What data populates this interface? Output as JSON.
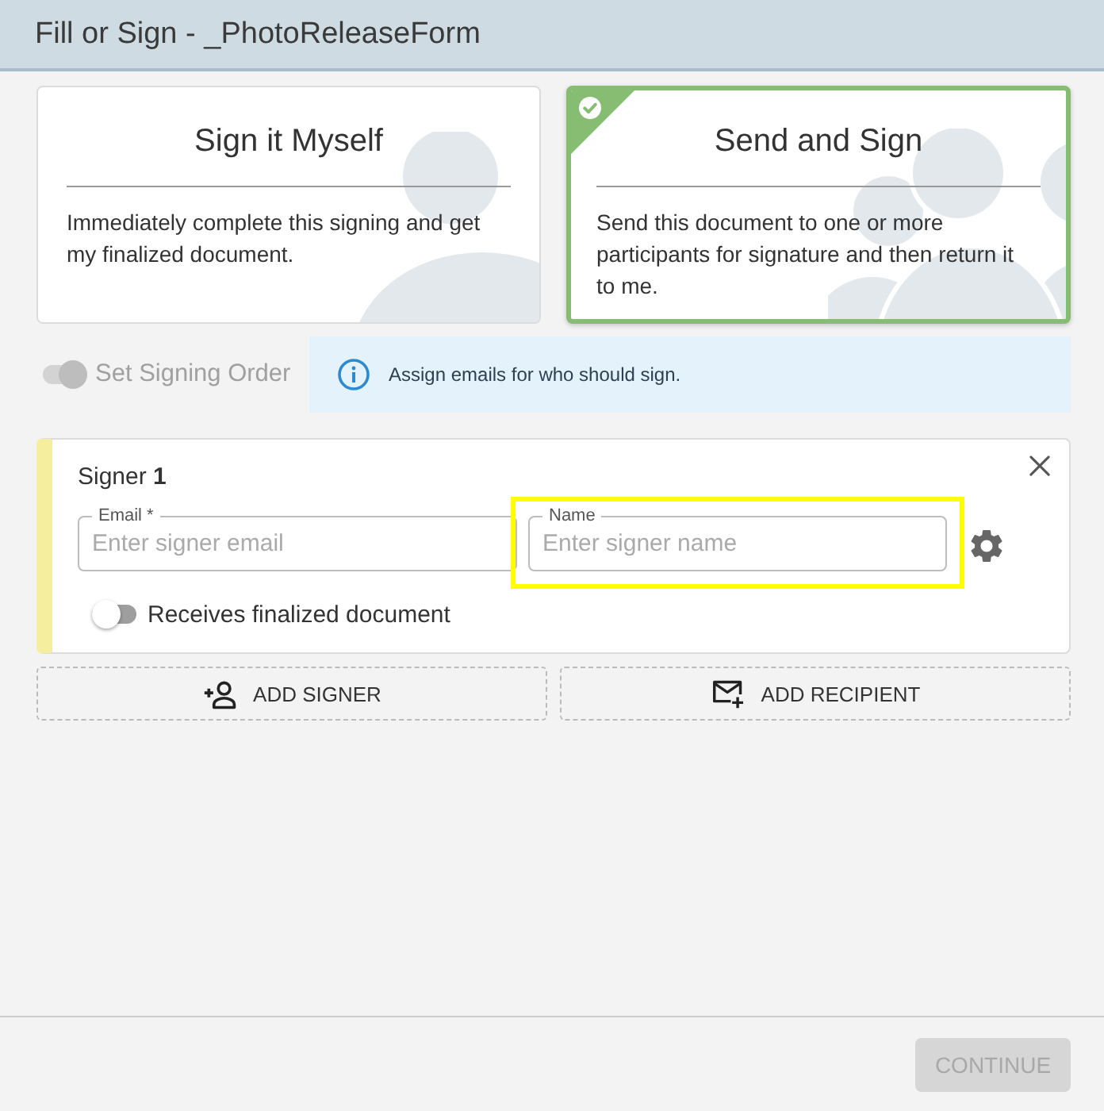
{
  "window": {
    "title": "Fill or Sign - _PhotoReleaseForm"
  },
  "options": [
    {
      "kind": "single",
      "title": "Sign it Myself",
      "description": "Immediately complete this signing and get my finalized document.",
      "selected": false
    },
    {
      "kind": "group",
      "title": "Send and Sign",
      "description": "Send this document to one or more participants for signature and then return it to me.",
      "selected": true
    }
  ],
  "signing_order": {
    "label": "Set Signing Order",
    "on": true,
    "disabled": true
  },
  "info": {
    "text": "Assign emails for who should sign."
  },
  "signers": [
    {
      "title": "Signer **1**",
      "fields": [
        {
          "label": "Email *",
          "placeholder": "Enter signer email",
          "highlighted": false
        },
        {
          "label": "Name",
          "placeholder": "Enter signer name",
          "highlighted": true
        }
      ],
      "receives_finalized": {
        "label": "Receives finalized document",
        "on": false
      }
    }
  ],
  "actions": [
    {
      "kind": "signer",
      "label": "ADD SIGNER"
    },
    {
      "kind": "recipient",
      "label": "ADD RECIPIENT"
    }
  ],
  "footer": {
    "continue": {
      "label": "CONTINUE",
      "disabled": true
    }
  }
}
